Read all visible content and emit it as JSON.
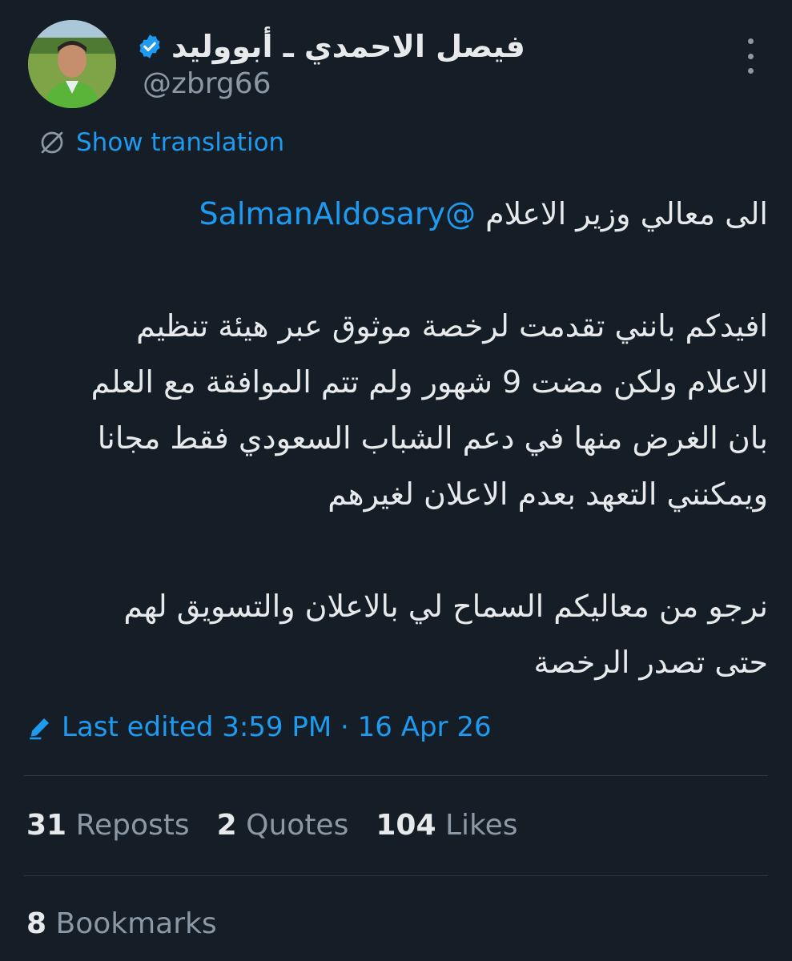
{
  "author": {
    "display_name": "فيصل الاحمدي ـ أبووليد",
    "handle": "@zbrg66",
    "verified": true,
    "avatar": "profile-photo"
  },
  "translation": {
    "label": "Show translation",
    "icon": "globe-off-icon"
  },
  "tweet": {
    "line1_prefix": "الى معالي وزير الاعلام ",
    "mention": "@SalmanAldosary",
    "paragraph2": [
      "افيدكم بانني تقدمت لرخصة موثوق عبر هيئة تنظيم",
      "الاعلام ولكن مضت 9 شهور ولم تتم الموافقة مع العلم",
      "بان الغرض منها في دعم الشباب السعودي فقط مجانا",
      "ويمكنني التعهد بعدم الاعلان لغيرهم"
    ],
    "paragraph3": [
      "نرجو من معاليكم السماح لي بالاعلان والتسويق لهم",
      "حتى تصدر الرخصة"
    ]
  },
  "edited": {
    "label": "Last edited 3:59 PM · 16 Apr 26",
    "icon": "pencil-icon"
  },
  "stats": {
    "reposts_count": "31",
    "reposts_label": "Reposts",
    "quotes_count": "2",
    "quotes_label": "Quotes",
    "likes_count": "104",
    "likes_label": "Likes",
    "bookmarks_count": "8",
    "bookmarks_label": "Bookmarks"
  },
  "colors": {
    "background": "#151d27",
    "text_primary": "#e7e9ea",
    "text_secondary": "#8b98a5",
    "accent": "#1d9bf0",
    "divider": "#2f3842"
  }
}
